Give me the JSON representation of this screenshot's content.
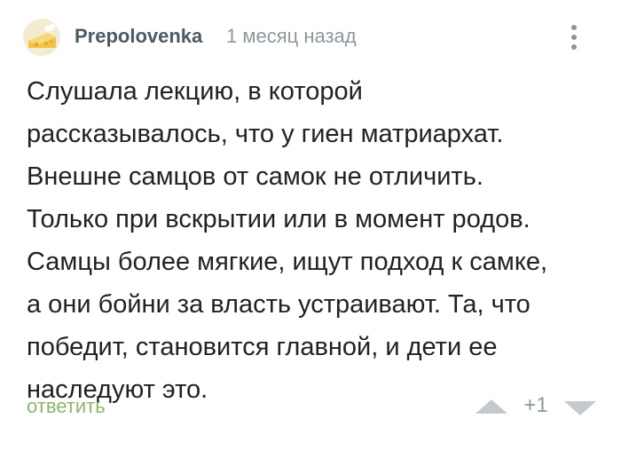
{
  "comment": {
    "author": "Prepolovenka",
    "timestamp": "1 месяц назад",
    "text_lines": [
      "Слушала лекцию, в которой",
      "рассказывалось, что у гиен матриархат.",
      "Внешне самцов от самок не отличить.",
      "Только при вскрытии или в момент родов.",
      "Самцы более мягкие, ищут подход к самке,",
      "а они бойни за власть устраивают. Та, что",
      "победит, становится главной, и дети ее",
      "наследуют это."
    ],
    "reply_label": "ответить",
    "rating": "+1"
  },
  "icons": {
    "avatar": "cheese-icon",
    "menu": "more-vertical-icon",
    "upvote": "triangle-up-icon",
    "downvote": "triangle-down-icon"
  },
  "colors": {
    "reply_link": "#8ab66b",
    "username": "#4b5a63",
    "muted": "#8e989e",
    "vote_arrow": "#c3c9cd"
  }
}
